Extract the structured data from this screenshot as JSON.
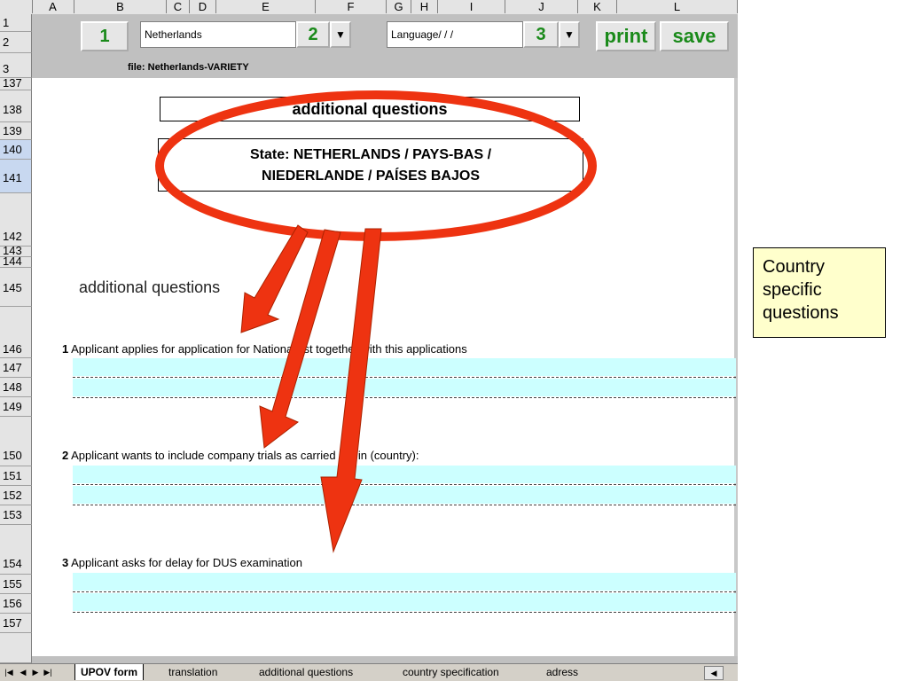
{
  "columns": [
    "A",
    "B",
    "C",
    "D",
    "E",
    "F",
    "G",
    "H",
    "I",
    "J",
    "K",
    "L"
  ],
  "toolbar": {
    "btn1": "1",
    "country": "Netherlands",
    "btn2": "2",
    "language": "Language/ / /",
    "btn3": "3",
    "print": "print",
    "save": "save",
    "dropdown_glyph": "▼",
    "file_label": "file:",
    "file_name": "Netherlands-VARIETY"
  },
  "rows": [
    "1",
    "2",
    "3",
    "137",
    "138",
    "139",
    "140",
    "141",
    "142",
    "143",
    "144",
    "145",
    "146",
    "147",
    "148",
    "149",
    "150",
    "151",
    "152",
    "153",
    "154",
    "155",
    "156",
    "157"
  ],
  "sheet": {
    "title_box": "additional questions",
    "state_line1": "State: NETHERLANDS / PAYS-BAS /",
    "state_line2": "NIEDERLANDE / PAÍSES BAJOS",
    "section_heading": "additional questions",
    "questions": [
      {
        "num": "1",
        "text": "Applicant applies for application for National list together with this applications"
      },
      {
        "num": "2",
        "text": "Applicant wants to include company trials as carried out in (country):"
      },
      {
        "num": "3",
        "text": "Applicant asks for delay for DUS examination"
      }
    ]
  },
  "tabs": [
    "UPOV form",
    "translation",
    "additional questions",
    "country specification",
    "adress"
  ],
  "note": "Country specific questions",
  "colors": {
    "green": "#1a8a1a",
    "cyan": "#ccffff",
    "annotation_red": "#ee3311",
    "note_bg": "#ffffcc"
  }
}
